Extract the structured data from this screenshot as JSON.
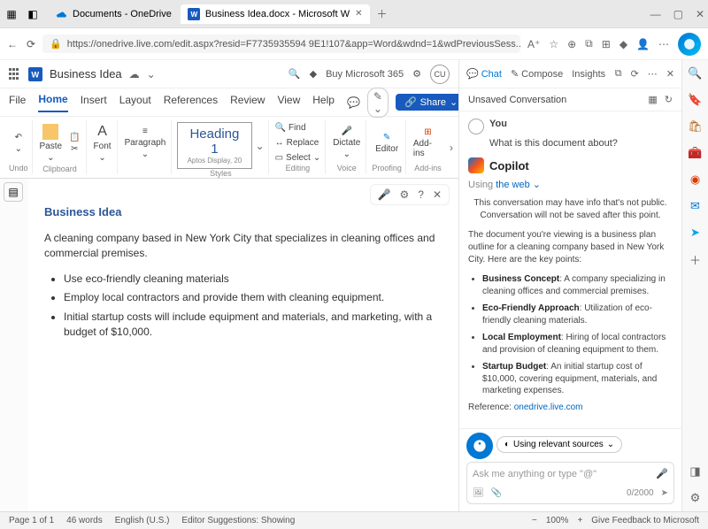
{
  "browser": {
    "tabs": [
      {
        "label": "Documents - OneDrive"
      },
      {
        "label": "Business Idea.docx - Microsoft W"
      }
    ],
    "url": "https://onedrive.live.com/edit.aspx?resid=F7735935594 9E1!107&app=Word&wdnd=1&wdPreviousSess..."
  },
  "word": {
    "doc_title": "Business Idea",
    "buy_label": "Buy Microsoft 365",
    "avatar": "CU",
    "tabs": [
      "File",
      "Home",
      "Insert",
      "Layout",
      "References",
      "Review",
      "View",
      "Help"
    ],
    "share_label": "Share",
    "ribbon": {
      "undo": "Undo",
      "paste": "Paste",
      "clipboard_label": "Clipboard",
      "font": "Font",
      "paragraph": "Paragraph",
      "styles_label": "Styles",
      "heading_title": "Heading 1",
      "heading_sub": "Aptos Display, 20",
      "find": "Find",
      "replace": "Replace",
      "select": "Select",
      "editing_label": "Editing",
      "dictate": "Dictate",
      "voice_label": "Voice",
      "editor": "Editor",
      "proofing_label": "Proofing",
      "addins": "Add-ins",
      "addins_label": "Add-ins"
    },
    "document": {
      "heading": "Business Idea",
      "para": "A cleaning company based in New York City that specializes in cleaning offices and commercial premises.",
      "bullets": [
        "Use eco-friendly cleaning materials",
        "Employ local contractors and provide them with cleaning equipment.",
        "Initial startup costs will include equipment and materials, and marketing, with a budget of $10,000."
      ]
    }
  },
  "copilot": {
    "tabs": {
      "chat": "Chat",
      "compose": "Compose",
      "insights": "Insights"
    },
    "subhead": "Unsaved Conversation",
    "you_label": "You",
    "you_msg": "What is this document about?",
    "name": "Copilot",
    "using": "Using ",
    "using_link": "the web",
    "disclaimer": "This conversation may have info that's not public. Conversation will not be saved after this point.",
    "intro": "The document you're viewing is a business plan outline for a cleaning company based in New York City. Here are the key points:",
    "points": [
      {
        "b": "Business Concept",
        "t": ": A company specializing in cleaning offices and commercial premises."
      },
      {
        "b": "Eco-Friendly Approach",
        "t": ": Utilization of eco-friendly cleaning materials."
      },
      {
        "b": "Local Employment",
        "t": ": Hiring of local contractors and provision of cleaning equipment to them."
      },
      {
        "b": "Startup Budget",
        "t": ": An initial startup cost of $10,000, covering equipment, materials, and marketing expenses."
      }
    ],
    "reference_label": "Reference: ",
    "reference_link": "onedrive.live.com",
    "source_label": "Using relevant sources",
    "placeholder": "Ask me anything or type \"@\"",
    "counter": "0/2000"
  },
  "statusbar": {
    "page": "Page 1 of 1",
    "words": "46 words",
    "lang": "English (U.S.)",
    "suggestions": "Editor Suggestions: Showing",
    "zoom": "100%",
    "feedback": "Give Feedback to Microsoft"
  }
}
